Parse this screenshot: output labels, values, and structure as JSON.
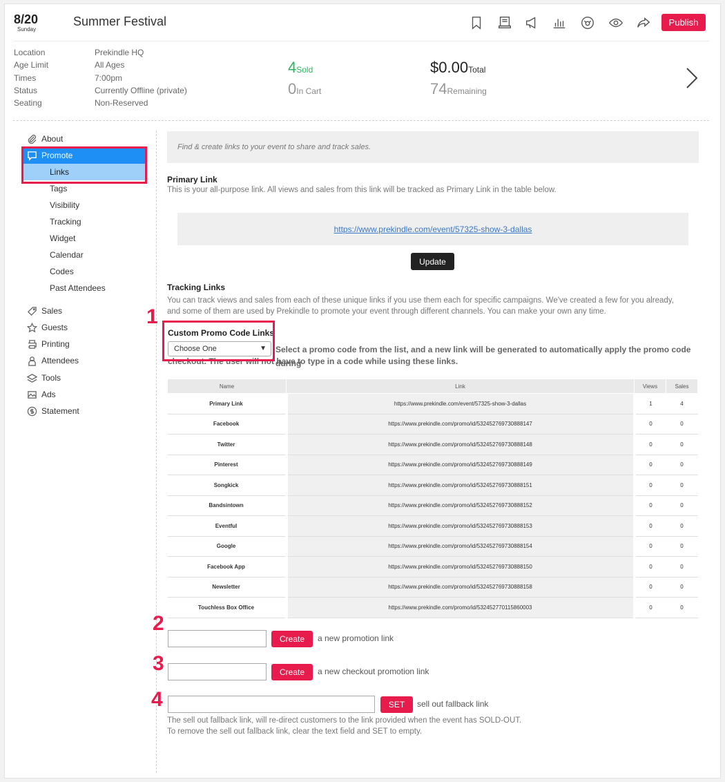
{
  "header": {
    "date": "8/20",
    "weekday": "Sunday",
    "title": "Summer Festival",
    "publish_label": "Publish",
    "icons": [
      "bookmark-icon",
      "ticket-icon",
      "megaphone-icon",
      "bar-chart-icon",
      "dashboard-icon",
      "eye-icon",
      "share-icon"
    ]
  },
  "info": [
    {
      "label": "Location",
      "value": "Prekindle HQ"
    },
    {
      "label": "Age Limit",
      "value": "All Ages"
    },
    {
      "label": "Times",
      "value": "7:00pm"
    },
    {
      "label": "Status",
      "value": "Currently Offline (private)"
    },
    {
      "label": "Seating",
      "value": "Non-Reserved"
    }
  ],
  "stats": {
    "sold": "4",
    "sold_label": "Sold",
    "in_cart": "0",
    "in_cart_label": "In Cart",
    "total": "$0.00",
    "total_label": "Total",
    "remaining": "74",
    "remaining_label": "Remaining",
    "sold_color": "#2bb65e"
  },
  "sidebar": {
    "items": [
      {
        "label": "About",
        "icon": "paperclip-icon"
      },
      {
        "label": "Promote",
        "icon": "speech-bubble-icon"
      },
      {
        "label": "Sales",
        "icon": "tag-icon"
      },
      {
        "label": "Guests",
        "icon": "star-icon"
      },
      {
        "label": "Printing",
        "icon": "printer-icon"
      },
      {
        "label": "Attendees",
        "icon": "person-icon"
      },
      {
        "label": "Tools",
        "icon": "layers-icon"
      },
      {
        "label": "Ads",
        "icon": "image-icon"
      },
      {
        "label": "Statement",
        "icon": "dollar-circle-icon"
      }
    ],
    "promote_sub": [
      "Links",
      "Tags",
      "Visibility",
      "Tracking",
      "Widget",
      "Calendar",
      "Codes",
      "Past Attendees"
    ],
    "active_color": "#1e90f5",
    "sub_active_color": "#9ed0fa"
  },
  "main": {
    "intro": "Find & create links to your event to share and track sales.",
    "primary_title": "Primary Link",
    "primary_desc": "This is your all-purpose link. All views and sales from this link will be tracked as Primary Link in the table below.",
    "primary_url": "https://www.prekindle.com/event/57325-show-3-dallas",
    "update_label": "Update",
    "tracking_title": "Tracking Links",
    "tracking_desc1": "You can track views and sales from each of these unique links if you use them each for specific campaigns. We've created a few for you already,",
    "tracking_desc2": "and some of them are used by Prekindle to promote your event through different channels. You can make your own any time.",
    "custom_title": "Custom Promo Code Links",
    "select_value": "Choose One",
    "custom_desc1": "Select a promo code from the list, and a new link will be generated to automatically apply the promo code during",
    "custom_desc2": "checkout. The user will not have to type in a code while using these links."
  },
  "table": {
    "headers": [
      "Name",
      "Link",
      "Views",
      "Sales"
    ],
    "rows": [
      {
        "name": "Primary Link",
        "link": "https://www.prekindle.com/event/57325-show-3-dallas",
        "views": "1",
        "sales": "4"
      },
      {
        "name": "Facebook",
        "link": "https://www.prekindle.com/promo/id/532452769730888147",
        "views": "0",
        "sales": "0"
      },
      {
        "name": "Twitter",
        "link": "https://www.prekindle.com/promo/id/532452769730888148",
        "views": "0",
        "sales": "0"
      },
      {
        "name": "Pinterest",
        "link": "https://www.prekindle.com/promo/id/532452769730888149",
        "views": "0",
        "sales": "0"
      },
      {
        "name": "Songkick",
        "link": "https://www.prekindle.com/promo/id/532452769730888151",
        "views": "0",
        "sales": "0"
      },
      {
        "name": "Bandsintown",
        "link": "https://www.prekindle.com/promo/id/532452769730888152",
        "views": "0",
        "sales": "0"
      },
      {
        "name": "Eventful",
        "link": "https://www.prekindle.com/promo/id/532452769730888153",
        "views": "0",
        "sales": "0"
      },
      {
        "name": "Google",
        "link": "https://www.prekindle.com/promo/id/532452769730888154",
        "views": "0",
        "sales": "0"
      },
      {
        "name": "Facebook App",
        "link": "https://www.prekindle.com/promo/id/532452769730888150",
        "views": "0",
        "sales": "0"
      },
      {
        "name": "Newsletter",
        "link": "https://www.prekindle.com/promo/id/532452769730888158",
        "views": "0",
        "sales": "0"
      },
      {
        "name": "Touchless Box Office",
        "link": "https://www.prekindle.com/promo/id/532452770115860003",
        "views": "0",
        "sales": "0"
      }
    ]
  },
  "forms": {
    "create_label": "Create",
    "promo_text": "a new promotion link",
    "checkout_text": "a new checkout promotion link",
    "set_label": "SET",
    "fallback_text": "sell out fallback link",
    "fallback_note1": "The sell out fallback link, will re-direct customers to the link provided when the event has SOLD-OUT.",
    "fallback_note2": "To remove the sell out fallback link, clear the text field and SET to empty.",
    "promo_value": "",
    "checkout_value": "",
    "fallback_value": ""
  },
  "annotations": [
    "1",
    "2",
    "3",
    "4"
  ],
  "accent_color": "#e81b4d"
}
